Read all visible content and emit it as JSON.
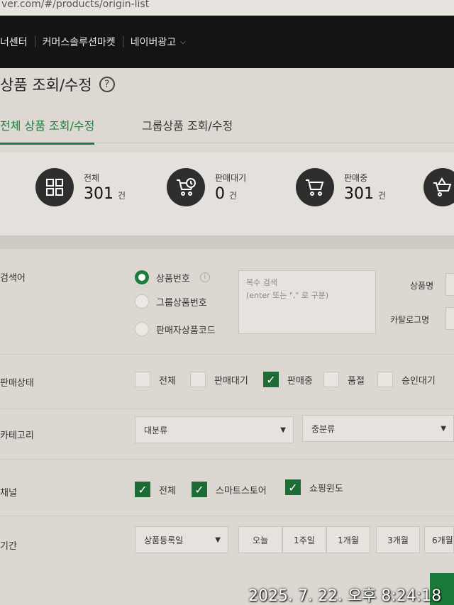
{
  "browser": {
    "url": "ver.com/#/products/origin-list"
  },
  "topnav": {
    "items": [
      "너센터",
      "커머스솔루션마켓",
      "네이버광고"
    ]
  },
  "page": {
    "title": "상품 조회/수정",
    "help": "?"
  },
  "tabs": [
    {
      "label": "전체 상품 조회/수정",
      "active": true
    },
    {
      "label": "그룹상품 조회/수정",
      "active": false
    }
  ],
  "summary": [
    {
      "label": "전체",
      "value": "301",
      "unit": "건",
      "icon": "grid-icon"
    },
    {
      "label": "판매대기",
      "value": "0",
      "unit": "건",
      "icon": "cart-clock-icon"
    },
    {
      "label": "판매중",
      "value": "301",
      "unit": "건",
      "icon": "cart-icon"
    },
    {
      "label": "",
      "value": "",
      "unit": "",
      "icon": "cart-alert-icon"
    }
  ],
  "search": {
    "label": "검색어",
    "options": [
      {
        "label": "상품번호",
        "selected": true
      },
      {
        "label": "그룹상품번호",
        "selected": false
      },
      {
        "label": "판매자상품코드",
        "selected": false
      }
    ],
    "textarea_placeholder_line1": "복수 검색",
    "textarea_placeholder_line2": "(enter 또는 \",\" 로 구분)",
    "product_name_label": "상품명",
    "catalog_name_label": "카탈로그명"
  },
  "sale_status": {
    "label": "판매상태",
    "options": [
      {
        "label": "전체",
        "checked": false
      },
      {
        "label": "판매대기",
        "checked": false
      },
      {
        "label": "판매중",
        "checked": true
      },
      {
        "label": "품절",
        "checked": false
      },
      {
        "label": "승인대기",
        "checked": false
      }
    ]
  },
  "category": {
    "label": "카테고리",
    "major": "대분류",
    "middle": "중분류"
  },
  "channel": {
    "label": "채널",
    "options": [
      {
        "label": "전체",
        "checked": true
      },
      {
        "label": "스마트스토어",
        "checked": true
      },
      {
        "label": "쇼핑윈도",
        "checked": true
      }
    ]
  },
  "period": {
    "label": "기간",
    "type": "상품등록일",
    "buttons": [
      "오늘",
      "1주일",
      "1개월",
      "3개월",
      "6개월"
    ]
  },
  "photo_timestamp": "2025. 7. 22. 오후 8:24:18",
  "colors": {
    "accent": "#1a7f3c",
    "nav_bg": "#141414",
    "check_bg": "#1d6b35"
  }
}
